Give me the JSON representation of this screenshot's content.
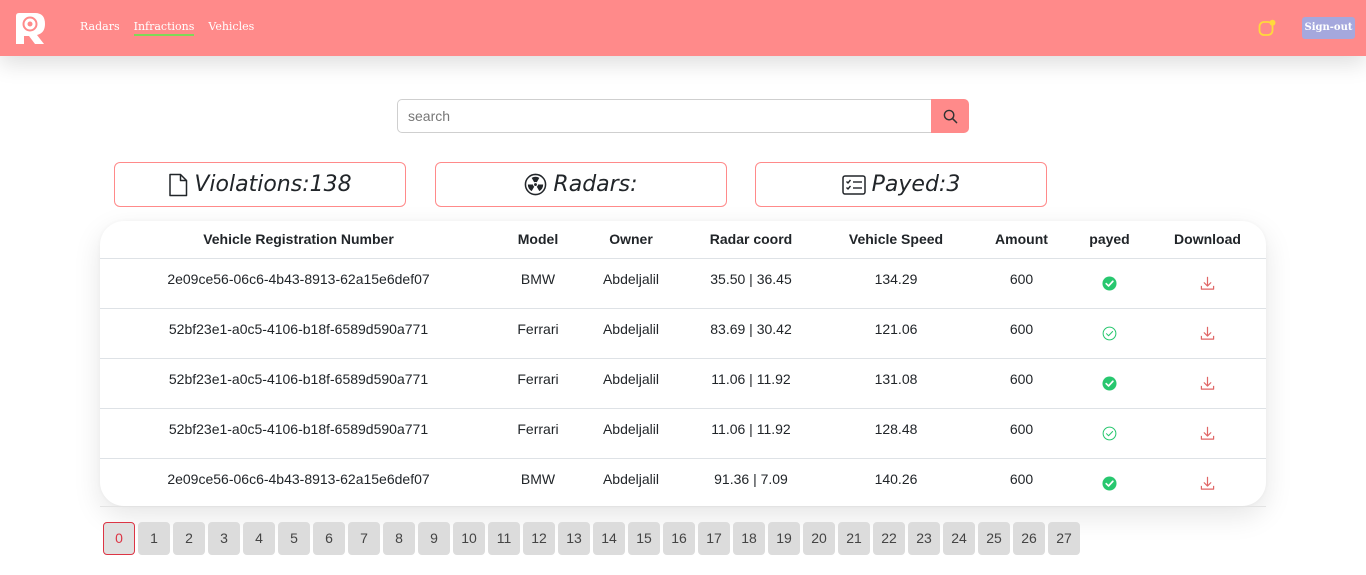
{
  "nav": {
    "links": [
      "Radars",
      "Infractions",
      "Vehicles"
    ],
    "active": "Infractions",
    "signout_label": "Sign-out"
  },
  "search": {
    "placeholder": "search",
    "value": ""
  },
  "stats": {
    "violations": "Violations:138",
    "radars": "Radars:",
    "payed": "Payed:3"
  },
  "table": {
    "headers": [
      "Vehicle Registration Number",
      "Model",
      "Owner",
      "Radar coord",
      "Vehicle Speed",
      "Amount",
      "payed",
      "Download"
    ],
    "rows": [
      {
        "reg": "2e09ce56-06c6-4b43-8913-62a15e6def07",
        "model": "BMW",
        "owner": "Abdeljalil",
        "coord": "35.50 | 36.45",
        "speed": "134.29",
        "amount": "600",
        "payed": true
      },
      {
        "reg": "52bf23e1-a0c5-4106-b18f-6589d590a771",
        "model": "Ferrari",
        "owner": "Abdeljalil",
        "coord": "83.69 | 30.42",
        "speed": "121.06",
        "amount": "600",
        "payed": false
      },
      {
        "reg": "52bf23e1-a0c5-4106-b18f-6589d590a771",
        "model": "Ferrari",
        "owner": "Abdeljalil",
        "coord": "11.06 | 11.92",
        "speed": "131.08",
        "amount": "600",
        "payed": true
      },
      {
        "reg": "52bf23e1-a0c5-4106-b18f-6589d590a771",
        "model": "Ferrari",
        "owner": "Abdeljalil",
        "coord": "11.06 | 11.92",
        "speed": "128.48",
        "amount": "600",
        "payed": false
      },
      {
        "reg": "2e09ce56-06c6-4b43-8913-62a15e6def07",
        "model": "BMW",
        "owner": "Abdeljalil",
        "coord": "91.36 | 7.09",
        "speed": "140.26",
        "amount": "600",
        "payed": true
      }
    ]
  },
  "pagination": {
    "pages": [
      "0",
      "1",
      "2",
      "3",
      "4",
      "5",
      "6",
      "7",
      "8",
      "9",
      "10",
      "11",
      "12",
      "13",
      "14",
      "15",
      "16",
      "17",
      "18",
      "19",
      "20",
      "21",
      "22",
      "23",
      "24",
      "25",
      "26",
      "27"
    ],
    "current": "0"
  },
  "colors": {
    "accent": "#ff8a8a",
    "signout_bg": "#a5a8dd",
    "success": "#28c76f",
    "download": "#e06666",
    "active_page": "#dc3545"
  },
  "icons": {
    "logo": "radar-logo-icon",
    "search": "search-icon",
    "notification": "notification-icon",
    "violations": "file-icon",
    "radars": "radioactive-icon",
    "payed": "checklist-icon",
    "payed_yes": "check-circle-filled-icon",
    "payed_no": "check-circle-outline-icon",
    "download": "download-icon"
  }
}
